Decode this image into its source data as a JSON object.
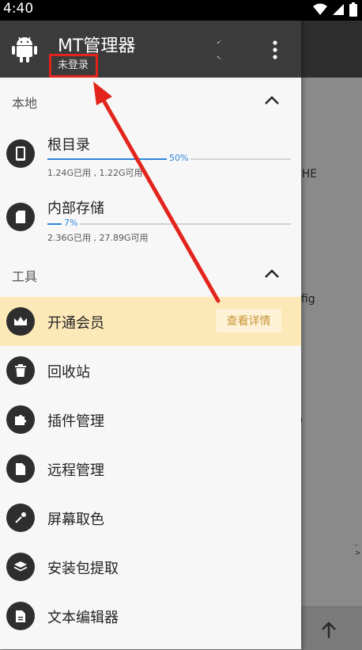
{
  "status_bar": {
    "time": "4:40"
  },
  "app": {
    "title": "MT管理器",
    "subtitle": "未登录"
  },
  "sections": {
    "local": "本地",
    "tools": "工具"
  },
  "storage": [
    {
      "name": "根目录",
      "percent": "50%",
      "fill": 0.5,
      "detail": "1.24G已用 , 1.22G可用"
    },
    {
      "name": "内部存储",
      "percent": "7%",
      "fill": 0.07,
      "detail": "2.36G已用 , 27.89G可用"
    }
  ],
  "tools": [
    {
      "label": "开通会员",
      "icon": "crown-icon"
    },
    {
      "label": "回收站",
      "icon": "trash-icon"
    },
    {
      "label": "插件管理",
      "icon": "puzzle-icon"
    },
    {
      "label": "远程管理",
      "icon": "file-icon"
    },
    {
      "label": "屏幕取色",
      "icon": "eyedropper-icon"
    },
    {
      "label": "安装包提取",
      "icon": "layers-icon"
    },
    {
      "label": "文本编辑器",
      "icon": "document-icon"
    }
  ],
  "vip_button": "查看详情",
  "background": {
    "text1": "e",
    "text2": "CHE",
    "text3": "nfig",
    "text4": "D",
    "text5": "->"
  },
  "colors": {
    "accent": "#2f86dc",
    "header": "#3b3b3b",
    "vip_bg": "#fde9b8",
    "annotation": "#e3241c"
  }
}
